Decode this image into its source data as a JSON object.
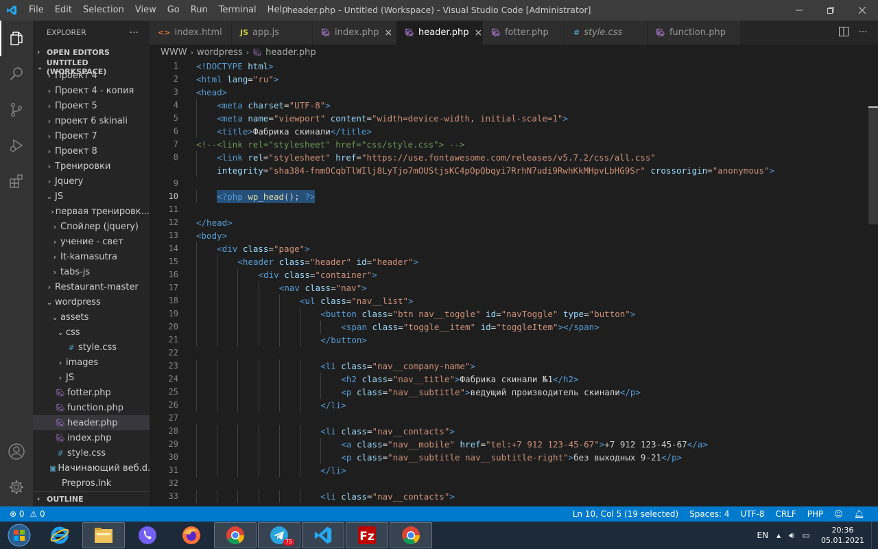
{
  "window": {
    "title": "header.php - Untitled (Workspace) - Visual Studio Code [Administrator]",
    "menu": [
      "File",
      "Edit",
      "Selection",
      "View",
      "Go",
      "Run",
      "Terminal",
      "Help"
    ]
  },
  "sidebar": {
    "title": "EXPLORER",
    "more": "···",
    "open_editors": "OPEN EDITORS",
    "workspace": "UNTITLED (WORKSPACE)",
    "outline": "OUTLINE",
    "items": [
      {
        "label": "Проект 4",
        "indent": 1,
        "type": "folder",
        "open": false
      },
      {
        "label": "Проект 4 - копия",
        "indent": 1,
        "type": "folder",
        "open": false
      },
      {
        "label": "Проект 5",
        "indent": 1,
        "type": "folder",
        "open": false
      },
      {
        "label": "проект 6 skinali",
        "indent": 1,
        "type": "folder",
        "open": false
      },
      {
        "label": "Проект 7",
        "indent": 1,
        "type": "folder",
        "open": false
      },
      {
        "label": "Проект 8",
        "indent": 1,
        "type": "folder",
        "open": false
      },
      {
        "label": "Тренировки",
        "indent": 1,
        "type": "folder",
        "open": false
      },
      {
        "label": "Jquery",
        "indent": 1,
        "type": "folder",
        "open": false
      },
      {
        "label": "JS",
        "indent": 1,
        "type": "folder",
        "open": true
      },
      {
        "label": "первая тренировк...",
        "indent": 2,
        "type": "folder",
        "open": false
      },
      {
        "label": "Спойлер (jquery)",
        "indent": 2,
        "type": "folder",
        "open": false
      },
      {
        "label": "учение - свет",
        "indent": 2,
        "type": "folder",
        "open": false
      },
      {
        "label": "It-kamasutra",
        "indent": 2,
        "type": "folder",
        "open": false
      },
      {
        "label": "tabs-js",
        "indent": 2,
        "type": "folder",
        "open": false
      },
      {
        "label": "Restaurant-master",
        "indent": 1,
        "type": "folder",
        "open": false
      },
      {
        "label": "wordpress",
        "indent": 1,
        "type": "folder",
        "open": true
      },
      {
        "label": "assets",
        "indent": 2,
        "type": "folder",
        "open": true
      },
      {
        "label": "css",
        "indent": 3,
        "type": "folder",
        "open": true
      },
      {
        "label": "style.css",
        "indent": 4,
        "type": "css"
      },
      {
        "label": "images",
        "indent": 3,
        "type": "folder",
        "open": false
      },
      {
        "label": "JS",
        "indent": 3,
        "type": "folder",
        "open": false
      },
      {
        "label": "fotter.php",
        "indent": 2,
        "type": "php"
      },
      {
        "label": "function.php",
        "indent": 2,
        "type": "php"
      },
      {
        "label": "header.php",
        "indent": 2,
        "type": "php",
        "selected": true
      },
      {
        "label": "index.php",
        "indent": 2,
        "type": "php"
      },
      {
        "label": "style.css",
        "indent": 2,
        "type": "css"
      },
      {
        "label": "Начинающий веб.d...",
        "indent": 1,
        "type": "doc"
      },
      {
        "label": "Prepros.lnk",
        "indent": 1,
        "type": "lnk"
      }
    ]
  },
  "tabs": [
    {
      "label": "index.html",
      "type": "html",
      "active": false
    },
    {
      "label": "app.js",
      "type": "js",
      "active": false
    },
    {
      "label": "index.php",
      "type": "php",
      "active": false,
      "close": true
    },
    {
      "label": "header.php",
      "type": "php",
      "active": true,
      "close": true
    },
    {
      "label": "fotter.php",
      "type": "php",
      "active": false
    },
    {
      "label": "style.css",
      "type": "css",
      "active": false
    },
    {
      "label": "function.php",
      "type": "php",
      "active": false
    }
  ],
  "breadcrumb": [
    "WWW",
    "wordpress",
    "header.php"
  ],
  "editor": {
    "current_line": 10,
    "lines": [
      {
        "n": "1",
        "indent": 0,
        "parts": [
          [
            "t",
            "<!DOCTYPE "
          ],
          [
            "a",
            "html"
          ],
          [
            "t",
            ">"
          ]
        ]
      },
      {
        "n": "2",
        "indent": 0,
        "parts": [
          [
            "t",
            "<html "
          ],
          [
            "a",
            "lang"
          ],
          [
            "x",
            "="
          ],
          [
            "s",
            "\"ru\""
          ],
          [
            "t",
            ">"
          ]
        ]
      },
      {
        "n": "3",
        "indent": 0,
        "parts": [
          [
            "t",
            "<head>"
          ]
        ]
      },
      {
        "n": "4",
        "indent": 1,
        "parts": [
          [
            "t",
            "<meta "
          ],
          [
            "a",
            "charset"
          ],
          [
            "x",
            "="
          ],
          [
            "s",
            "\"UTF-8\""
          ],
          [
            "t",
            ">"
          ]
        ]
      },
      {
        "n": "5",
        "indent": 1,
        "parts": [
          [
            "t",
            "<meta "
          ],
          [
            "a",
            "name"
          ],
          [
            "x",
            "="
          ],
          [
            "s",
            "\"viewport\""
          ],
          [
            "x",
            " "
          ],
          [
            "a",
            "content"
          ],
          [
            "x",
            "="
          ],
          [
            "s",
            "\"width=device-width, initial-scale=1\""
          ],
          [
            "t",
            ">"
          ]
        ]
      },
      {
        "n": "6",
        "indent": 1,
        "parts": [
          [
            "t",
            "<title>"
          ],
          [
            "x",
            "Фабрика скинали"
          ],
          [
            "t",
            "</title>"
          ]
        ]
      },
      {
        "n": "7",
        "indent": 0,
        "parts": [
          [
            "c",
            "<!--<link rel=\"stylesheet\" href=\"css/style.css\"> -->"
          ]
        ]
      },
      {
        "n": "8",
        "indent": 1,
        "parts": [
          [
            "t",
            "<link "
          ],
          [
            "a",
            "rel"
          ],
          [
            "x",
            "="
          ],
          [
            "s",
            "\"stylesheet\""
          ],
          [
            "x",
            " "
          ],
          [
            "a",
            "href"
          ],
          [
            "x",
            "="
          ],
          [
            "s",
            "\"https://use.fontawesome.com/releases/v5.7.2/css/all.css\""
          ]
        ]
      },
      {
        "n": "",
        "indent": 1,
        "parts": [
          [
            "a",
            "integrity"
          ],
          [
            "x",
            "="
          ],
          [
            "s",
            "\"sha384-fnmOCqbTlWIlj8LyTjo7mOUStjsKC4pOpQbqyi7RrhN7udi9RwhKkMHpvLbHG9Sr\""
          ],
          [
            "x",
            " "
          ],
          [
            "a",
            "crossorigin"
          ],
          [
            "x",
            "="
          ],
          [
            "s",
            "\"anonymous\""
          ],
          [
            "t",
            ">"
          ]
        ]
      },
      {
        "n": "9",
        "indent": 0,
        "parts": []
      },
      {
        "n": "10",
        "indent": 1,
        "selected": true,
        "parts": [
          [
            "t",
            "<?php "
          ],
          [
            "f",
            "wp_head"
          ],
          [
            "x",
            "(); "
          ],
          [
            "t",
            "?>"
          ]
        ]
      },
      {
        "n": "11",
        "indent": 0,
        "parts": []
      },
      {
        "n": "12",
        "indent": 0,
        "parts": [
          [
            "t",
            "</head>"
          ]
        ]
      },
      {
        "n": "13",
        "indent": 0,
        "parts": [
          [
            "t",
            "<body>"
          ]
        ]
      },
      {
        "n": "14",
        "indent": 1,
        "parts": [
          [
            "t",
            "<div "
          ],
          [
            "a",
            "class"
          ],
          [
            "x",
            "="
          ],
          [
            "s",
            "\"page\""
          ],
          [
            "t",
            ">"
          ]
        ]
      },
      {
        "n": "15",
        "indent": 2,
        "parts": [
          [
            "t",
            "<header "
          ],
          [
            "a",
            "class"
          ],
          [
            "x",
            "="
          ],
          [
            "s",
            "\"header\""
          ],
          [
            "x",
            " "
          ],
          [
            "a",
            "id"
          ],
          [
            "x",
            "="
          ],
          [
            "s",
            "\"header\""
          ],
          [
            "t",
            ">"
          ]
        ]
      },
      {
        "n": "16",
        "indent": 3,
        "parts": [
          [
            "t",
            "<div "
          ],
          [
            "a",
            "class"
          ],
          [
            "x",
            "="
          ],
          [
            "s",
            "\"container\""
          ],
          [
            "t",
            ">"
          ]
        ]
      },
      {
        "n": "17",
        "indent": 4,
        "parts": [
          [
            "t",
            "<nav "
          ],
          [
            "a",
            "class"
          ],
          [
            "x",
            "="
          ],
          [
            "s",
            "\"nav\""
          ],
          [
            "t",
            ">"
          ]
        ]
      },
      {
        "n": "18",
        "indent": 5,
        "parts": [
          [
            "t",
            "<ul "
          ],
          [
            "a",
            "class"
          ],
          [
            "x",
            "="
          ],
          [
            "s",
            "\"nav__list\""
          ],
          [
            "t",
            ">"
          ]
        ]
      },
      {
        "n": "19",
        "indent": 6,
        "parts": [
          [
            "t",
            "<button "
          ],
          [
            "a",
            "class"
          ],
          [
            "x",
            "="
          ],
          [
            "s",
            "\"btn nav__toggle\""
          ],
          [
            "x",
            " "
          ],
          [
            "a",
            "id"
          ],
          [
            "x",
            "="
          ],
          [
            "s",
            "\"navToggle\""
          ],
          [
            "x",
            " "
          ],
          [
            "a",
            "type"
          ],
          [
            "x",
            "="
          ],
          [
            "s",
            "\"button\""
          ],
          [
            "t",
            ">"
          ]
        ]
      },
      {
        "n": "20",
        "indent": 7,
        "parts": [
          [
            "t",
            "<span "
          ],
          [
            "a",
            "class"
          ],
          [
            "x",
            "="
          ],
          [
            "s",
            "\"toggle__item\""
          ],
          [
            "x",
            " "
          ],
          [
            "a",
            "id"
          ],
          [
            "x",
            "="
          ],
          [
            "s",
            "\"toggleItem\""
          ],
          [
            "t",
            "></span>"
          ]
        ]
      },
      {
        "n": "21",
        "indent": 6,
        "parts": [
          [
            "t",
            "</button>"
          ]
        ]
      },
      {
        "n": "22",
        "indent": 0,
        "parts": []
      },
      {
        "n": "23",
        "indent": 6,
        "parts": [
          [
            "t",
            "<li "
          ],
          [
            "a",
            "class"
          ],
          [
            "x",
            "="
          ],
          [
            "s",
            "\"nav__company-name\""
          ],
          [
            "t",
            ">"
          ]
        ]
      },
      {
        "n": "24",
        "indent": 7,
        "parts": [
          [
            "t",
            "<h2 "
          ],
          [
            "a",
            "class"
          ],
          [
            "x",
            "="
          ],
          [
            "s",
            "\"nav__title\""
          ],
          [
            "t",
            ">"
          ],
          [
            "x",
            "Фабрика скинали №1"
          ],
          [
            "t",
            "</h2>"
          ]
        ]
      },
      {
        "n": "25",
        "indent": 7,
        "parts": [
          [
            "t",
            "<p "
          ],
          [
            "a",
            "class"
          ],
          [
            "x",
            "="
          ],
          [
            "s",
            "\"nav__subtitle\""
          ],
          [
            "t",
            ">"
          ],
          [
            "x",
            "ведущий производитель скинали"
          ],
          [
            "t",
            "</p>"
          ]
        ]
      },
      {
        "n": "26",
        "indent": 6,
        "parts": [
          [
            "t",
            "</li>"
          ]
        ]
      },
      {
        "n": "27",
        "indent": 0,
        "parts": []
      },
      {
        "n": "28",
        "indent": 6,
        "parts": [
          [
            "t",
            "<li "
          ],
          [
            "a",
            "class"
          ],
          [
            "x",
            "="
          ],
          [
            "s",
            "\"nav__contacts\""
          ],
          [
            "t",
            ">"
          ]
        ]
      },
      {
        "n": "29",
        "indent": 7,
        "parts": [
          [
            "t",
            "<a "
          ],
          [
            "a",
            "class"
          ],
          [
            "x",
            "="
          ],
          [
            "s",
            "\"nav__mobile\""
          ],
          [
            "x",
            " "
          ],
          [
            "a",
            "href"
          ],
          [
            "x",
            "="
          ],
          [
            "s",
            "\"tel:+7 912 123-45-67\""
          ],
          [
            "t",
            ">"
          ],
          [
            "x",
            "+7 912 123-45-67"
          ],
          [
            "t",
            "</a>"
          ]
        ]
      },
      {
        "n": "30",
        "indent": 7,
        "parts": [
          [
            "t",
            "<p "
          ],
          [
            "a",
            "class"
          ],
          [
            "x",
            "="
          ],
          [
            "s",
            "\"nav__subtitle nav__subtitle-right\""
          ],
          [
            "t",
            ">"
          ],
          [
            "x",
            "без выходных 9-21"
          ],
          [
            "t",
            "</p>"
          ]
        ]
      },
      {
        "n": "31",
        "indent": 6,
        "parts": [
          [
            "t",
            "</li>"
          ]
        ]
      },
      {
        "n": "32",
        "indent": 0,
        "parts": []
      },
      {
        "n": "33",
        "indent": 6,
        "parts": [
          [
            "t",
            "<li "
          ],
          [
            "a",
            "class"
          ],
          [
            "x",
            "="
          ],
          [
            "s",
            "\"nav__contacts\""
          ],
          [
            "t",
            ">"
          ]
        ]
      }
    ]
  },
  "statusbar": {
    "errors": "0",
    "warnings": "0",
    "position": "Ln 10, Col 5 (19 selected)",
    "spaces": "Spaces: 4",
    "encoding": "UTF-8",
    "eol": "CRLF",
    "language": "PHP"
  },
  "taskbar": {
    "apps": [
      "start-orb",
      "internet-explorer",
      "file-explorer",
      "viber",
      "firefox",
      "chrome",
      "telegram",
      "vscode",
      "filezilla",
      "chrome-2"
    ],
    "telegram_badge": "75",
    "lang": "EN",
    "time": "20:36",
    "date": "05.01.2021"
  },
  "colors": {
    "accent": "#007acc",
    "php_icon": "#a074c4",
    "css_icon": "#519aba",
    "js_icon": "#cbcb41",
    "html_icon": "#e37933"
  }
}
